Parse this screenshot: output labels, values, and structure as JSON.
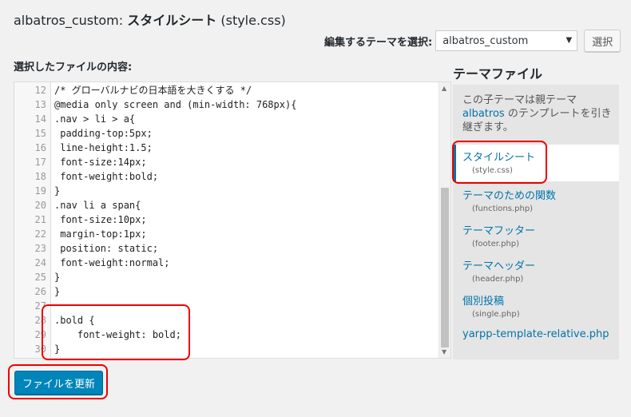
{
  "page": {
    "title_prefix": "albatros_custom:",
    "title_main": "スタイルシート",
    "title_suffix": "(style.css)"
  },
  "theme_select": {
    "label": "編集するテーマを選択:",
    "value": "albatros_custom",
    "button": "選択"
  },
  "editor": {
    "label": "選択したファイルの内容:",
    "lines": [
      {
        "n": "12",
        "code": "/* グローバルナビの日本語を大きくする */"
      },
      {
        "n": "13",
        "code": "@media only screen and (min-width: 768px){"
      },
      {
        "n": "14",
        "code": ".nav > li > a{"
      },
      {
        "n": "15",
        "code": " padding-top:5px;"
      },
      {
        "n": "16",
        "code": " line-height:1.5;"
      },
      {
        "n": "17",
        "code": " font-size:14px;"
      },
      {
        "n": "18",
        "code": " font-weight:bold;"
      },
      {
        "n": "19",
        "code": "}"
      },
      {
        "n": "20",
        "code": ".nav li a span{"
      },
      {
        "n": "21",
        "code": " font-size:10px;"
      },
      {
        "n": "22",
        "code": " margin-top:1px;"
      },
      {
        "n": "23",
        "code": " position: static;"
      },
      {
        "n": "24",
        "code": " font-weight:normal;"
      },
      {
        "n": "25",
        "code": "}"
      },
      {
        "n": "26",
        "code": "}"
      },
      {
        "n": "27",
        "code": ""
      },
      {
        "n": "28",
        "code": ".bold {"
      },
      {
        "n": "29",
        "code": "    font-weight: bold;"
      },
      {
        "n": "30",
        "code": "}"
      }
    ]
  },
  "sidebar": {
    "title": "テーマファイル",
    "desc_before": "この子テーマは親テーマ",
    "desc_link": "albatros",
    "desc_after": "のテンプレートを引き継ぎます。",
    "files": [
      {
        "name": "スタイルシート",
        "sub": "(style.css)"
      },
      {
        "name": "テーマのための関数",
        "sub": "(functions.php)"
      },
      {
        "name": "テーマフッター",
        "sub": "(footer.php)"
      },
      {
        "name": "テーマヘッダー",
        "sub": "(header.php)"
      },
      {
        "name": "個別投稿",
        "sub": "(single.php)"
      },
      {
        "name": "yarpp-template-relative.php",
        "sub": ""
      }
    ]
  },
  "update_button": "ファイルを更新",
  "colors": {
    "accent": "#0073aa",
    "primary_button": "#0085ba",
    "annotation": "#e00000"
  }
}
